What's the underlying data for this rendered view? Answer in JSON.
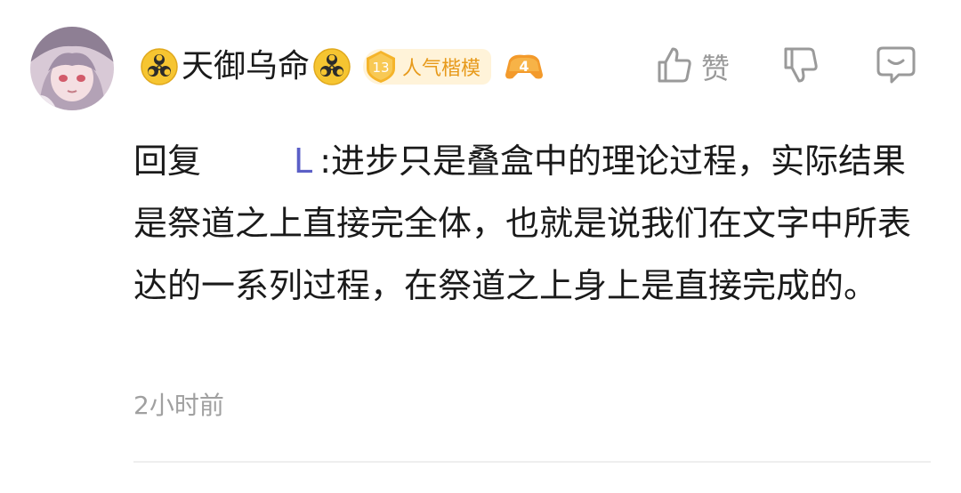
{
  "comment": {
    "username": "天御乌命",
    "level": {
      "number": "13",
      "title": "人气楷模"
    },
    "tier_badge": "4",
    "reply_prefix": "回复",
    "reply_target": "L",
    "reply_text": ":进步只是叠盒中的理论过程，实际结果是祭道之上直接完全体，也就是说我们在文字中所表达的一系列过程，在祭道之上身上是直接完成的。",
    "timestamp": "2小时前"
  },
  "actions": {
    "like_label": "赞"
  },
  "icons": {
    "name_badge": "biohazard-icon",
    "level_shield": "diamond-shield-icon",
    "tier": "gamepad-icon",
    "like": "thumbs-up-icon",
    "dislike": "thumbs-down-icon",
    "reply": "comment-icon"
  },
  "colors": {
    "reply_target": "#5b5fc7",
    "level_title": "#e79a1b",
    "badge_bg": "#fff3d9",
    "muted": "#9a9a9a"
  }
}
